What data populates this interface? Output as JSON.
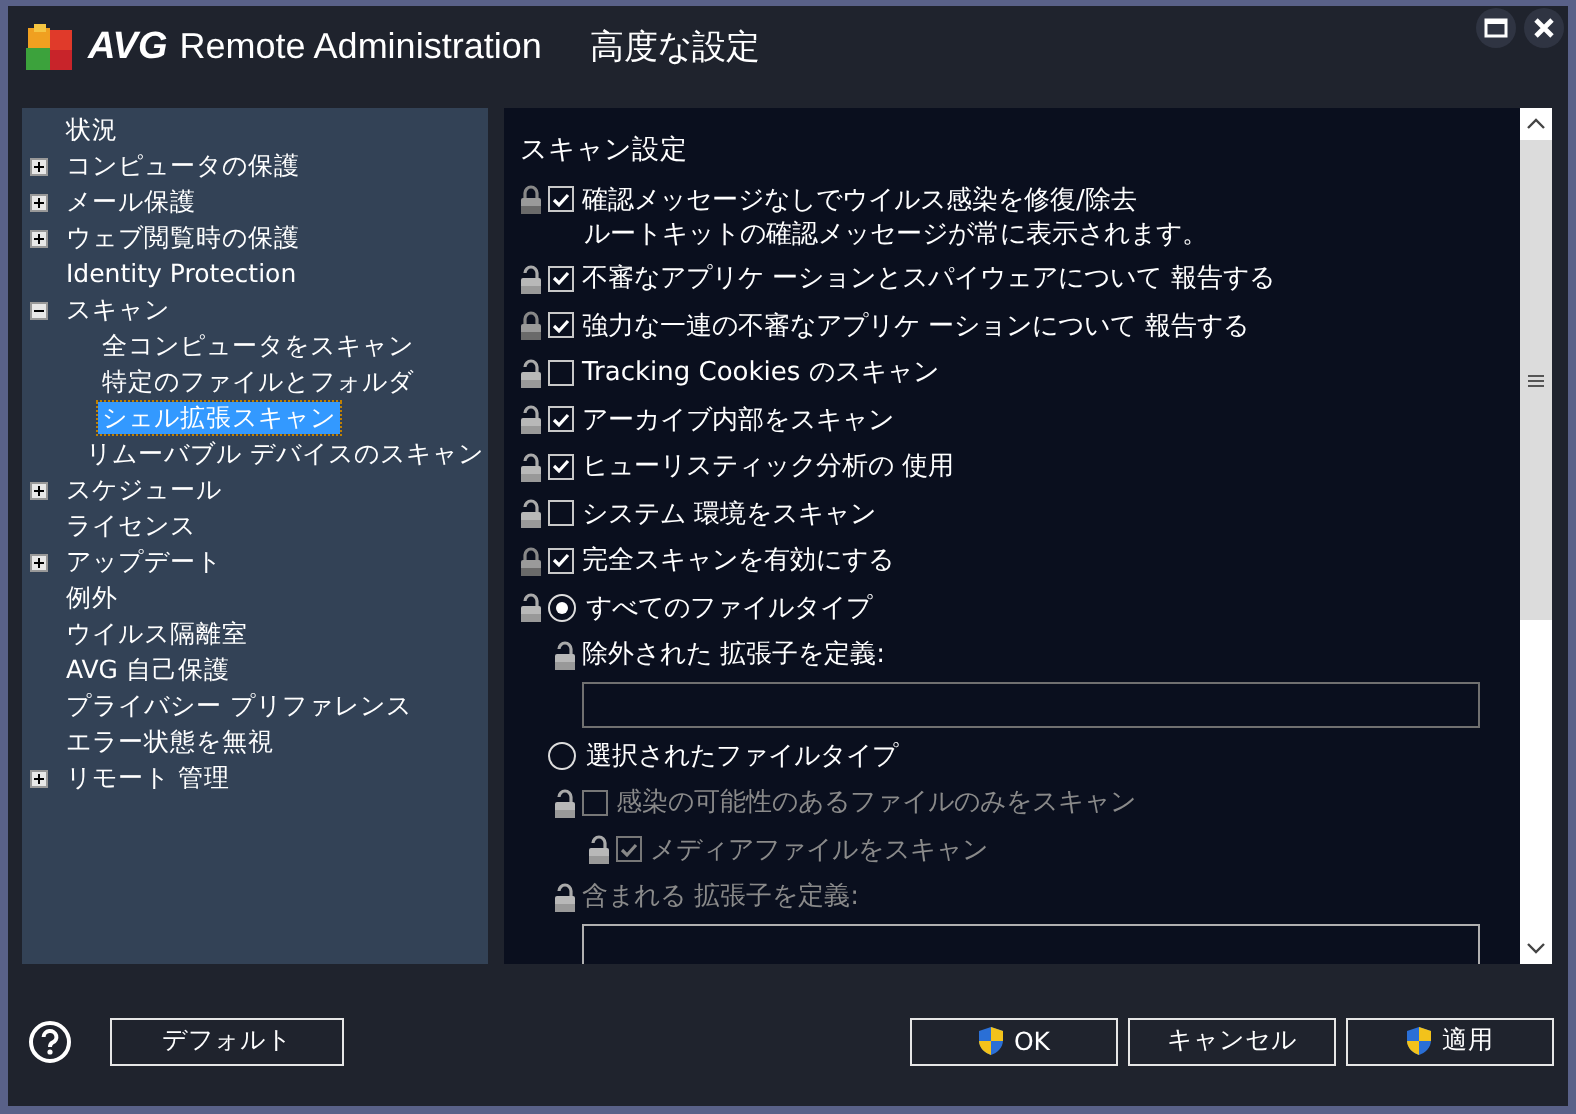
{
  "window": {
    "brand": "AVG",
    "product": "Remote Administration",
    "title": "高度な設定"
  },
  "tree": [
    {
      "label": "状況",
      "selected": false
    },
    {
      "label": "コンピュータの保護",
      "selected": false,
      "expanded": false
    },
    {
      "label": "メール保護",
      "selected": false,
      "expanded": false
    },
    {
      "label": "ウェブ閲覧時の保護",
      "selected": false,
      "expanded": false
    },
    {
      "label": "Identity Protection",
      "selected": false
    },
    {
      "label": "スキャン",
      "selected": false,
      "expanded": true,
      "children": [
        {
          "label": "全コンピュータをスキャン",
          "selected": false
        },
        {
          "label": "特定のファイルとフォルダ",
          "selected": false
        },
        {
          "label": "シェル拡張スキャン",
          "selected": true
        },
        {
          "label": "リムーバブル デバイスのスキャン",
          "selected": false
        }
      ]
    },
    {
      "label": "スケジュール",
      "selected": false,
      "expanded": false
    },
    {
      "label": "ライセンス",
      "selected": false
    },
    {
      "label": "アップデート",
      "selected": false,
      "expanded": false
    },
    {
      "label": "例外",
      "selected": false
    },
    {
      "label": "ウイルス隔離室",
      "selected": false
    },
    {
      "label": "AVG 自己保護",
      "selected": false
    },
    {
      "label": "プライバシー プリファレンス",
      "selected": false
    },
    {
      "label": "エラー状態を無視",
      "selected": false
    },
    {
      "label": "リモート 管理",
      "selected": false,
      "expanded": false
    }
  ],
  "settings": {
    "heading": "スキャン設定",
    "items": [
      {
        "kind": "checkbox",
        "label": "確認メッセージなしでウイルス感染を修復/除去",
        "note": "ルートキットの確認メッセージが常に表示されます。",
        "checked": true,
        "locked": true,
        "disabled": false
      },
      {
        "kind": "checkbox",
        "label": "不審なアプリケ ーションとスパイウェアについて 報告する",
        "checked": true,
        "locked": false,
        "disabled": false
      },
      {
        "kind": "checkbox",
        "label": "強力な一連の不審なアプリケ ーションについて 報告する",
        "checked": true,
        "locked": true,
        "disabled": false
      },
      {
        "kind": "checkbox",
        "label": "Tracking Cookies のスキャン",
        "checked": false,
        "locked": false,
        "disabled": false
      },
      {
        "kind": "checkbox",
        "label": "アーカイブ内部をスキャン",
        "checked": true,
        "locked": false,
        "disabled": false
      },
      {
        "kind": "checkbox",
        "label": "ヒューリスティック分析の 使用",
        "checked": true,
        "locked": false,
        "disabled": false
      },
      {
        "kind": "checkbox",
        "label": "システム 環境をスキャン",
        "checked": false,
        "locked": false,
        "disabled": false
      },
      {
        "kind": "checkbox",
        "label": "完全スキャンを有効にする",
        "checked": true,
        "locked": true,
        "disabled": false
      },
      {
        "kind": "radio",
        "label": "すべてのファイルタイプ",
        "selected": true,
        "locked": false,
        "children": [
          {
            "kind": "label",
            "label": "除外された 拡張子を定義:",
            "locked": false,
            "disabled": false
          },
          {
            "kind": "field",
            "disabled": false
          }
        ]
      },
      {
        "kind": "radio",
        "label": "選択されたファイルタイプ",
        "selected": false,
        "children": [
          {
            "kind": "checkbox",
            "label": "感染の可能性のあるファイルのみをスキャン",
            "checked": false,
            "locked": false,
            "disabled": true,
            "children": [
              {
                "kind": "checkbox",
                "label": "メディアファイルをスキャン",
                "checked": true,
                "locked": false,
                "disabled": true
              }
            ]
          },
          {
            "kind": "label",
            "label": "含まれる 拡張子を定義:",
            "locked": false,
            "disabled": true
          },
          {
            "kind": "field",
            "disabled": true
          }
        ]
      }
    ]
  },
  "buttons": [
    {
      "kind": "default",
      "label": "デフォルト"
    },
    {
      "kind": "ok",
      "label": "OK",
      "shield": true
    },
    {
      "kind": "cancel",
      "label": "キャンセル"
    },
    {
      "kind": "apply",
      "label": "適用",
      "shield": true
    }
  ]
}
